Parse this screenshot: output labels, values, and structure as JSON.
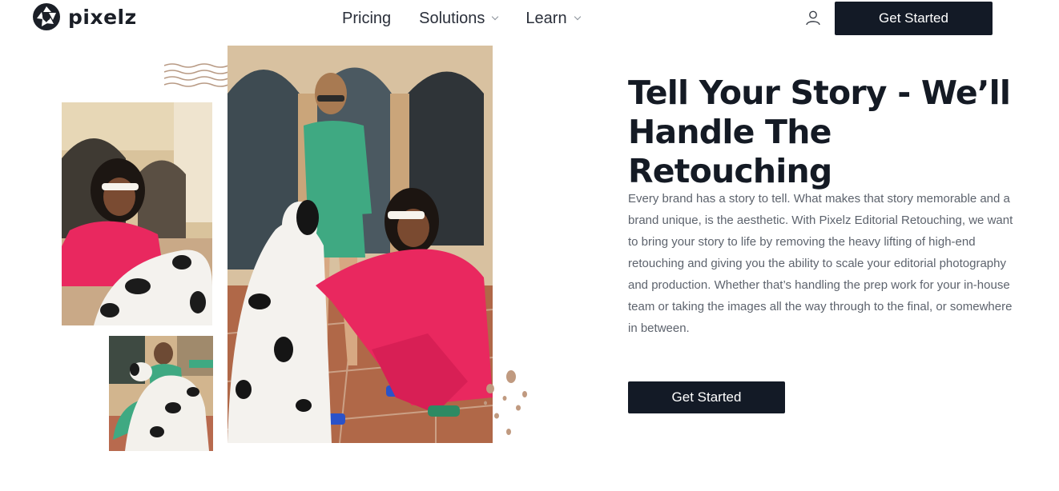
{
  "brand": {
    "name": "pixelz",
    "logo_icon": "aperture-logo-icon"
  },
  "nav": {
    "items": [
      {
        "label": "Pricing",
        "has_dropdown": false
      },
      {
        "label": "Solutions",
        "has_dropdown": true
      },
      {
        "label": "Learn",
        "has_dropdown": true
      }
    ]
  },
  "header": {
    "account_icon": "user-icon",
    "cta_label": "Get Started"
  },
  "hero": {
    "headline": "Tell Your Story - We’ll Handle The Retouching",
    "body": "Every brand has a story to tell. What makes that story memorable and a brand unique, is the aesthetic. With Pixelz Editorial Retouching, we want to bring your story to life by removing the heavy lifting of high-end retouching and giving you the ability to scale your editorial photography and production. Whether that’s handling the prep work for your in-house team or taking the images all the way through to the final, or somewhere in between.",
    "cta_label": "Get Started"
  },
  "colors": {
    "dark": "#131a26",
    "pink": "#e9285f",
    "green": "#3fa982",
    "terracotta": "#b98a72"
  }
}
